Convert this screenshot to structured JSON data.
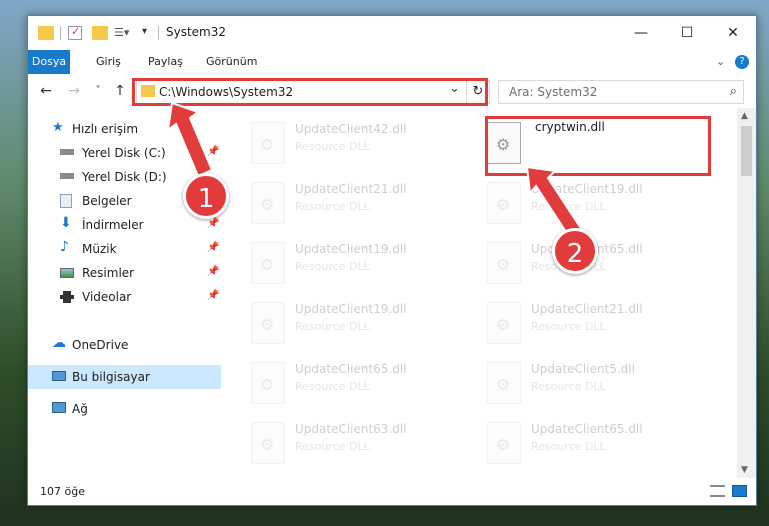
{
  "window": {
    "title": "System32",
    "controls": {
      "minimize": "—",
      "maximize": "☐",
      "close": "✕"
    }
  },
  "ribbon": {
    "tabs": [
      {
        "label": "Dosya",
        "active": true
      },
      {
        "label": "Giriş"
      },
      {
        "label": "Paylaş"
      },
      {
        "label": "Görünüm"
      }
    ],
    "expand_icon": "chevron-down-icon",
    "help": "?"
  },
  "navigation": {
    "back": "←",
    "forward": "→",
    "recent": "˅",
    "up": "↑",
    "address": "C:\\Windows\\System32",
    "address_dropdown": "⌄",
    "refresh": "↻",
    "search_placeholder": "Ara: System32",
    "search_icon": "🔍"
  },
  "sidebar": {
    "items": [
      {
        "label": "Hızlı erişim",
        "icon": "star-icon",
        "pinned": false
      },
      {
        "label": "Yerel Disk (C:)",
        "icon": "drive-icon",
        "pinned": true
      },
      {
        "label": "Yerel Disk (D:)",
        "icon": "drive-icon",
        "pinned": true
      },
      {
        "label": "Belgeler",
        "icon": "documents-icon",
        "pinned": true
      },
      {
        "label": "İndirmeler",
        "icon": "download-icon",
        "pinned": true
      },
      {
        "label": "Müzik",
        "icon": "music-icon",
        "pinned": true
      },
      {
        "label": "Resimler",
        "icon": "pictures-icon",
        "pinned": true
      },
      {
        "label": "Videolar",
        "icon": "video-icon",
        "pinned": true
      },
      {
        "label": "OneDrive",
        "icon": "cloud-icon",
        "pinned": false
      },
      {
        "label": "Bu bilgisayar",
        "icon": "computer-icon",
        "pinned": false,
        "selected": true
      },
      {
        "label": "Ağ",
        "icon": "network-icon",
        "pinned": false
      }
    ],
    "pin_glyph": "📌"
  },
  "files": {
    "highlighted": {
      "name": "cryptwin.dll"
    },
    "left_column": [
      {
        "name": "UpdateClient42.dll",
        "desc": "Resource DLL"
      },
      {
        "name": "UpdateClient21.dll",
        "desc": "Resource DLL"
      },
      {
        "name": "UpdateClient19.dll",
        "desc": "Resource DLL"
      },
      {
        "name": "UpdateClient19.dll",
        "desc": "Resource DLL"
      },
      {
        "name": "UpdateClient65.dll",
        "desc": "Resource DLL"
      },
      {
        "name": "UpdateClient63.dll",
        "desc": "Resource DLL"
      }
    ],
    "right_column": [
      {
        "name": "UpdateClient19.dll",
        "desc": "Resource DLL"
      },
      {
        "name": "UpdateClient65.dll",
        "desc": "Resource DLL"
      },
      {
        "name": "UpdateClient21.dll",
        "desc": "Resource DLL"
      },
      {
        "name": "UpdateClient5.dll",
        "desc": "Resource DLL"
      },
      {
        "name": "UpdateClient65.dll",
        "desc": "Resource DLL"
      }
    ]
  },
  "status": {
    "item_count": "107 öğe"
  },
  "annotations": {
    "badge_1": "1",
    "badge_2": "2",
    "highlight_color": "#e23b3b"
  },
  "colors": {
    "accent": "#1979ca",
    "selection": "#cce8ff",
    "annotation": "#e23b3b"
  }
}
